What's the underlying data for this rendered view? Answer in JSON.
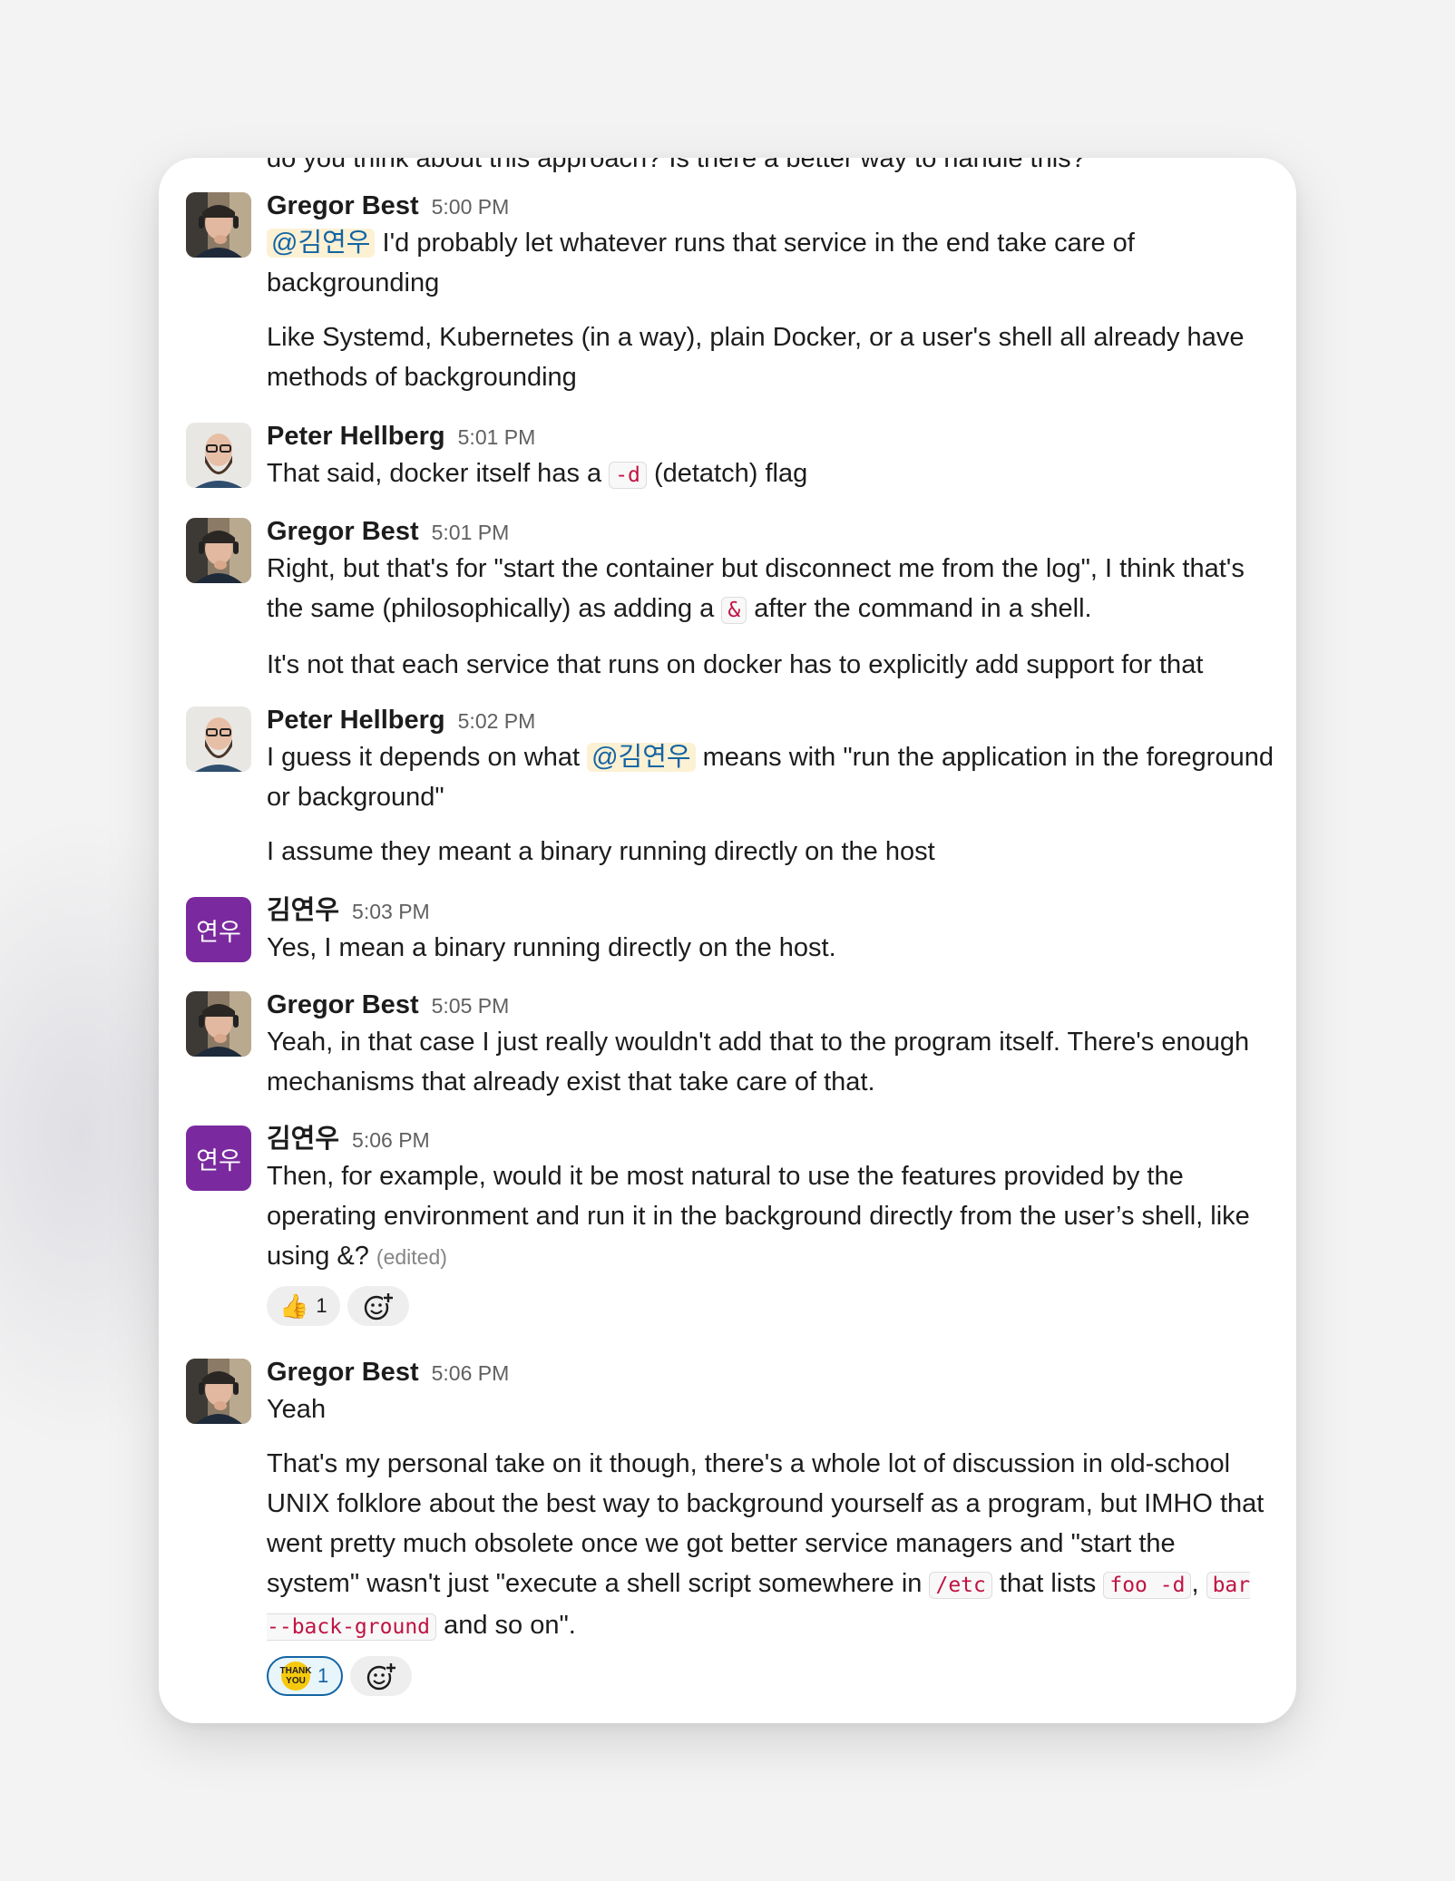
{
  "cutoff_text": "do you think about this approach? Is there a better way to handle this?",
  "messages": [
    {
      "author": "Gregor Best",
      "time": "5:00 PM",
      "avatar": "gregor-avatar",
      "p1": {
        "mention": "@김연우",
        "text": " I'd probably let whatever runs that service in the end take care of backgrounding"
      },
      "p2": "Like Systemd, Kubernetes (in a way), plain Docker, or a user's shell all already have methods of backgrounding"
    },
    {
      "author": "Peter Hellberg",
      "time": "5:01 PM",
      "avatar": "peter-avatar",
      "p1": {
        "before": "That said, docker itself has a ",
        "code": "-d",
        "after": " (detatch) flag"
      }
    },
    {
      "author": "Gregor Best",
      "time": "5:01 PM",
      "avatar": "gregor-avatar",
      "p1": {
        "before": "Right, but that's for \"start the container but disconnect me from the log\", I think that's the same (philosophically) as adding a ",
        "code": "&",
        "after": " after the command in a shell."
      },
      "p2": "It's not that each service that runs on docker has to explicitly add support for that"
    },
    {
      "author": "Peter Hellberg",
      "time": "5:02 PM",
      "avatar": "peter-avatar",
      "p1": {
        "before": "I guess it depends on what ",
        "mention": "@김연우",
        "after": " means with \"run the application in the foreground or background\""
      },
      "p2": "I assume they meant a binary running directly on the host"
    },
    {
      "author": "김연우",
      "time": "5:03 PM",
      "avatar_initials": "연우",
      "p1": "Yes, I mean a binary running directly on the host."
    },
    {
      "author": "Gregor Best",
      "time": "5:05 PM",
      "avatar": "gregor-avatar",
      "p1": "Yeah, in that case I just really wouldn't add that to the program itself. There's enough mechanisms that already exist that take care of that."
    },
    {
      "author": "김연우",
      "time": "5:06 PM",
      "avatar_initials": "연우",
      "p1": "Then, for example, would it be most natural to use the features provided by the operating environment and run it in the background directly from the user’s shell, like using &?",
      "edited": "(edited)",
      "reaction": {
        "emoji": "👍",
        "count": "1"
      }
    },
    {
      "author": "Gregor Best",
      "time": "5:06 PM",
      "avatar": "gregor-avatar",
      "p1": "Yeah",
      "p2": {
        "t1": "That's my personal take on it though, there's a whole lot of discussion in old-school UNIX folklore about the best way to background yourself as a program, but IMHO that went pretty much obsolete once we got better service managers and \"start the system\" wasn't just \"execute a shell script somewhere in ",
        "c1": "/etc",
        "t2": " that lists ",
        "c2": "foo -d",
        "t3": ", ",
        "c3": "bar --back-ground",
        "t4": " and so on\"."
      },
      "reaction": {
        "emoji": "thank-you-emoji",
        "emoji_text_1": "THANK",
        "emoji_text_2": "YOU",
        "count": "1"
      }
    }
  ]
}
